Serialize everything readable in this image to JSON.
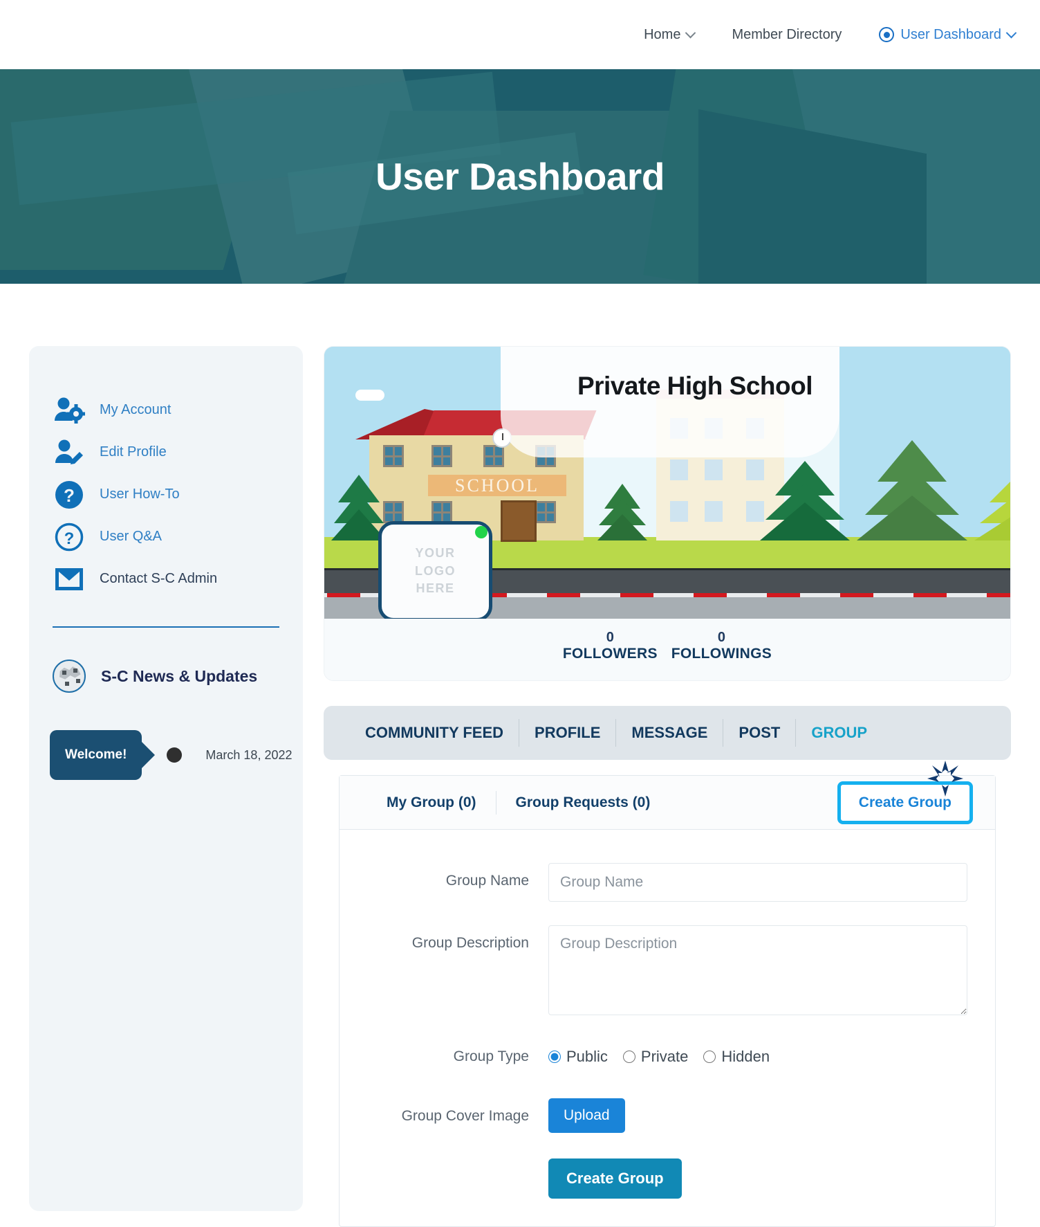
{
  "nav": {
    "items": [
      {
        "label": "Home",
        "caret": true,
        "active": false,
        "icon": "chevron-down-icon"
      },
      {
        "label": "Member Directory",
        "caret": false,
        "active": false,
        "icon": ""
      },
      {
        "label": "User Dashboard",
        "caret": true,
        "active": true,
        "icon": "radio-selected-icon"
      }
    ]
  },
  "hero": {
    "title": "User Dashboard"
  },
  "sidebar": {
    "items": [
      {
        "label": "My Account",
        "icon": "user-gear-icon",
        "style": "link"
      },
      {
        "label": "Edit Profile",
        "icon": "user-edit-icon",
        "style": "link"
      },
      {
        "label": "User How-To",
        "icon": "help-filled-icon",
        "style": "link"
      },
      {
        "label": "User Q&A",
        "icon": "help-outline-icon",
        "style": "link"
      },
      {
        "label": "Contact S-C Admin",
        "icon": "envelope-icon",
        "style": "dark"
      }
    ],
    "news": {
      "title": "S-C News & Updates",
      "icon": "globe-icon"
    },
    "welcome": {
      "tag": "Welcome!",
      "date": "March 18, 2022"
    }
  },
  "profile": {
    "cover_name": "Private High School",
    "school_sign": "SCHOOL",
    "avatar_text": "YOUR\nLOGO\nHERE",
    "avatar_line1": "YOUR",
    "avatar_line2": "LOGO",
    "avatar_line3": "HERE",
    "status": "online",
    "stats": [
      {
        "num": "0",
        "label": "FOLLOWERS"
      },
      {
        "num": "0",
        "label": "FOLLOWINGS"
      }
    ]
  },
  "tabs": [
    {
      "label": "COMMUNITY FEED",
      "active": false
    },
    {
      "label": "PROFILE",
      "active": false
    },
    {
      "label": "MESSAGE",
      "active": false
    },
    {
      "label": "POST",
      "active": false
    },
    {
      "label": "GROUP",
      "active": true
    }
  ],
  "group": {
    "subtabs": [
      {
        "label": "My Group (0)"
      },
      {
        "label": "Group Requests (0)"
      }
    ],
    "create_tab": "Create Group",
    "form": {
      "name_label": "Group Name",
      "name_placeholder": "Group Name",
      "name_value": "",
      "desc_label": "Group Description",
      "desc_placeholder": "Group Description",
      "desc_value": "",
      "type_label": "Group Type",
      "type_options": [
        {
          "label": "Public",
          "checked": true
        },
        {
          "label": "Private",
          "checked": false
        },
        {
          "label": "Hidden",
          "checked": false
        }
      ],
      "cover_label": "Group Cover Image",
      "upload_label": "Upload",
      "submit_label": "Create Group"
    }
  },
  "colors": {
    "hero_teal": "#1d5d6b",
    "link_blue": "#2f7fc4",
    "navy": "#1f2a54",
    "active_tab_cyan": "#17a2c9",
    "highlight_cyan": "#14b0ef",
    "upload_blue": "#1a84d8",
    "submit_blue": "#1189b5",
    "online_green": "#22d34a"
  }
}
